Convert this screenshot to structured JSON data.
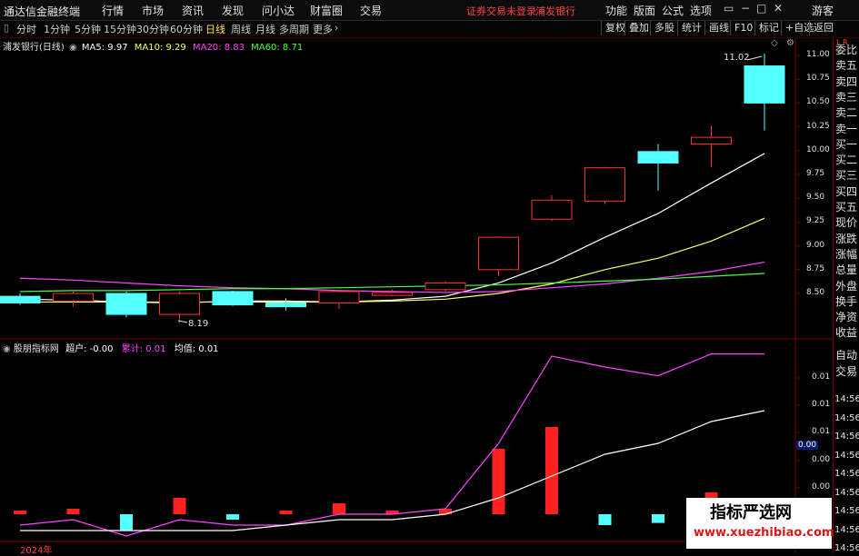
{
  "titlebar": {
    "app_name": "通达信金融终端",
    "menus": [
      "行情",
      "市场",
      "资讯",
      "发现",
      "问小达",
      "财富圈",
      "交易"
    ],
    "alert": "证券交易未登录",
    "stock": "浦发银行",
    "right_menus": [
      "功能",
      "版面",
      "公式",
      "选项"
    ],
    "guest": "游客"
  },
  "periods": [
    "分时",
    "1分钟",
    "5分钟",
    "15分钟",
    "30分钟",
    "60分钟",
    "日线",
    "周线",
    "月线",
    "多周期",
    "更多"
  ],
  "active_period": "日线",
  "toolbar_buttons": [
    "复权",
    "叠加",
    "多股",
    "统计",
    "画线",
    "F10",
    "标记",
    "+自选",
    "返回"
  ],
  "main_chart": {
    "title": "浦发银行(日线)",
    "ma_labels": [
      {
        "text": "MA5: 9.97",
        "color": "#ffffff"
      },
      {
        "text": "MA10: 9.29",
        "color": "#ffff66"
      },
      {
        "text": "MA20: 8.83",
        "color": "#ff44ff"
      },
      {
        "text": "MA60: 8.71",
        "color": "#44ff44"
      }
    ],
    "high_label": "11.02",
    "low_label": "8.19",
    "y_ticks": [
      "11.00",
      "10.75",
      "10.50",
      "10.25",
      "10.00",
      "9.75",
      "9.50",
      "9.25",
      "9.00",
      "8.75",
      "8.50"
    ]
  },
  "sub_chart": {
    "title": "股朋指标网",
    "values": [
      {
        "text": "超户: -0.00",
        "color": "#ffffff"
      },
      {
        "text": "累计: 0.01",
        "color": "#ff44ff"
      },
      {
        "text": "均值: 0.01",
        "color": "#ffffff"
      }
    ],
    "y_ticks": [
      "0.01",
      "0.01",
      "0.01",
      "0.00",
      "0.00",
      "0.00"
    ],
    "highlight": "0.00"
  },
  "right_panel": {
    "header": "L R",
    "items": [
      "委比",
      "卖五",
      "卖四",
      "卖三",
      "卖二",
      "卖一",
      "买一",
      "买二",
      "买三",
      "买四",
      "买五",
      "现价",
      "涨跌",
      "涨幅",
      "总量",
      "外盘",
      "换手",
      "净资",
      "收益",
      "自动",
      "交易"
    ],
    "times": [
      "14:56",
      "14:56",
      "14:56",
      "14:56",
      "14:56",
      "14:56",
      "14:56",
      "14:56",
      "14:56"
    ]
  },
  "footer": {
    "year": "2024年"
  },
  "watermark": {
    "title": "指标严选网",
    "url": "www.xuezhibiao.com"
  },
  "chart_data": [
    {
      "type": "candlestick",
      "title": "浦发银行(日线)",
      "ylim": [
        8.0,
        11.3
      ],
      "candles": [
        {
          "open": 8.4,
          "close": 8.47,
          "high": 8.5,
          "low": 8.38,
          "up": false
        },
        {
          "open": 8.5,
          "close": 8.42,
          "high": 8.52,
          "low": 8.36,
          "up": true
        },
        {
          "open": 8.5,
          "close": 8.28,
          "high": 8.52,
          "low": 8.25,
          "up": false
        },
        {
          "open": 8.28,
          "close": 8.5,
          "high": 8.52,
          "low": 8.19,
          "up": true
        },
        {
          "open": 8.38,
          "close": 8.52,
          "high": 8.53,
          "low": 8.37,
          "up": false
        },
        {
          "open": 8.4,
          "close": 8.36,
          "high": 8.45,
          "low": 8.32,
          "up": false
        },
        {
          "open": 8.4,
          "close": 8.52,
          "high": 8.54,
          "low": 8.34,
          "up": true
        },
        {
          "open": 8.48,
          "close": 8.51,
          "high": 8.54,
          "low": 8.47,
          "up": true
        },
        {
          "open": 8.54,
          "close": 8.61,
          "high": 8.63,
          "low": 8.52,
          "up": true
        },
        {
          "open": 8.75,
          "close": 9.09,
          "high": 9.1,
          "low": 8.68,
          "up": true
        },
        {
          "open": 9.28,
          "close": 9.48,
          "high": 9.53,
          "low": 9.26,
          "up": true
        },
        {
          "open": 9.47,
          "close": 9.82,
          "high": 9.83,
          "low": 9.44,
          "up": true
        },
        {
          "open": 9.99,
          "close": 9.87,
          "high": 10.07,
          "low": 9.58,
          "up": false
        },
        {
          "open": 10.07,
          "close": 10.14,
          "high": 10.26,
          "low": 9.83,
          "up": true
        },
        {
          "open": 10.89,
          "close": 10.5,
          "high": 11.02,
          "low": 10.21,
          "up": false
        }
      ],
      "series": [
        {
          "name": "MA5",
          "color": "#ffffff",
          "values": [
            8.44,
            8.43,
            8.41,
            8.4,
            8.42,
            8.42,
            8.41,
            8.43,
            8.47,
            8.61,
            8.82,
            9.09,
            9.34,
            9.66,
            9.97
          ]
        },
        {
          "name": "MA10",
          "color": "#ffff66",
          "values": [
            8.41,
            8.41,
            8.41,
            8.41,
            8.41,
            8.41,
            8.41,
            8.42,
            8.44,
            8.5,
            8.6,
            8.75,
            8.87,
            9.05,
            9.29
          ]
        },
        {
          "name": "MA20",
          "color": "#ff44ff",
          "values": [
            8.66,
            8.64,
            8.61,
            8.58,
            8.56,
            8.55,
            8.53,
            8.52,
            8.51,
            8.52,
            8.56,
            8.6,
            8.66,
            8.73,
            8.83
          ]
        },
        {
          "name": "MA60",
          "color": "#44ff44",
          "values": [
            8.52,
            8.53,
            8.53,
            8.54,
            8.55,
            8.55,
            8.56,
            8.57,
            8.58,
            8.59,
            8.61,
            8.63,
            8.65,
            8.68,
            8.71
          ]
        }
      ]
    },
    {
      "type": "bar",
      "title": "股朋指标网",
      "series": [
        {
          "name": "超户",
          "values": [
            0.0,
            0.0005,
            -0.0015,
            0.0015,
            -0.0005,
            0.0,
            0.001,
            0.0,
            0.0005,
            0.006,
            0.008,
            -0.001,
            -0.0008,
            0.002,
            0.0
          ]
        },
        {
          "name": "累计",
          "color": "#ff44ff",
          "values": [
            0.0,
            0.0005,
            -0.001,
            0.0005,
            0.0,
            0.0,
            0.001,
            0.001,
            0.0015,
            0.0075,
            0.0155,
            0.0145,
            0.0137,
            0.0157,
            0.0157
          ]
        },
        {
          "name": "均值",
          "color": "#ffffff",
          "values": [
            0.0,
            0.0,
            0.0,
            0.0,
            0.0,
            0.0005,
            0.001,
            0.001,
            0.0015,
            0.003,
            0.005,
            0.007,
            0.008,
            0.01,
            0.011
          ]
        }
      ]
    }
  ]
}
